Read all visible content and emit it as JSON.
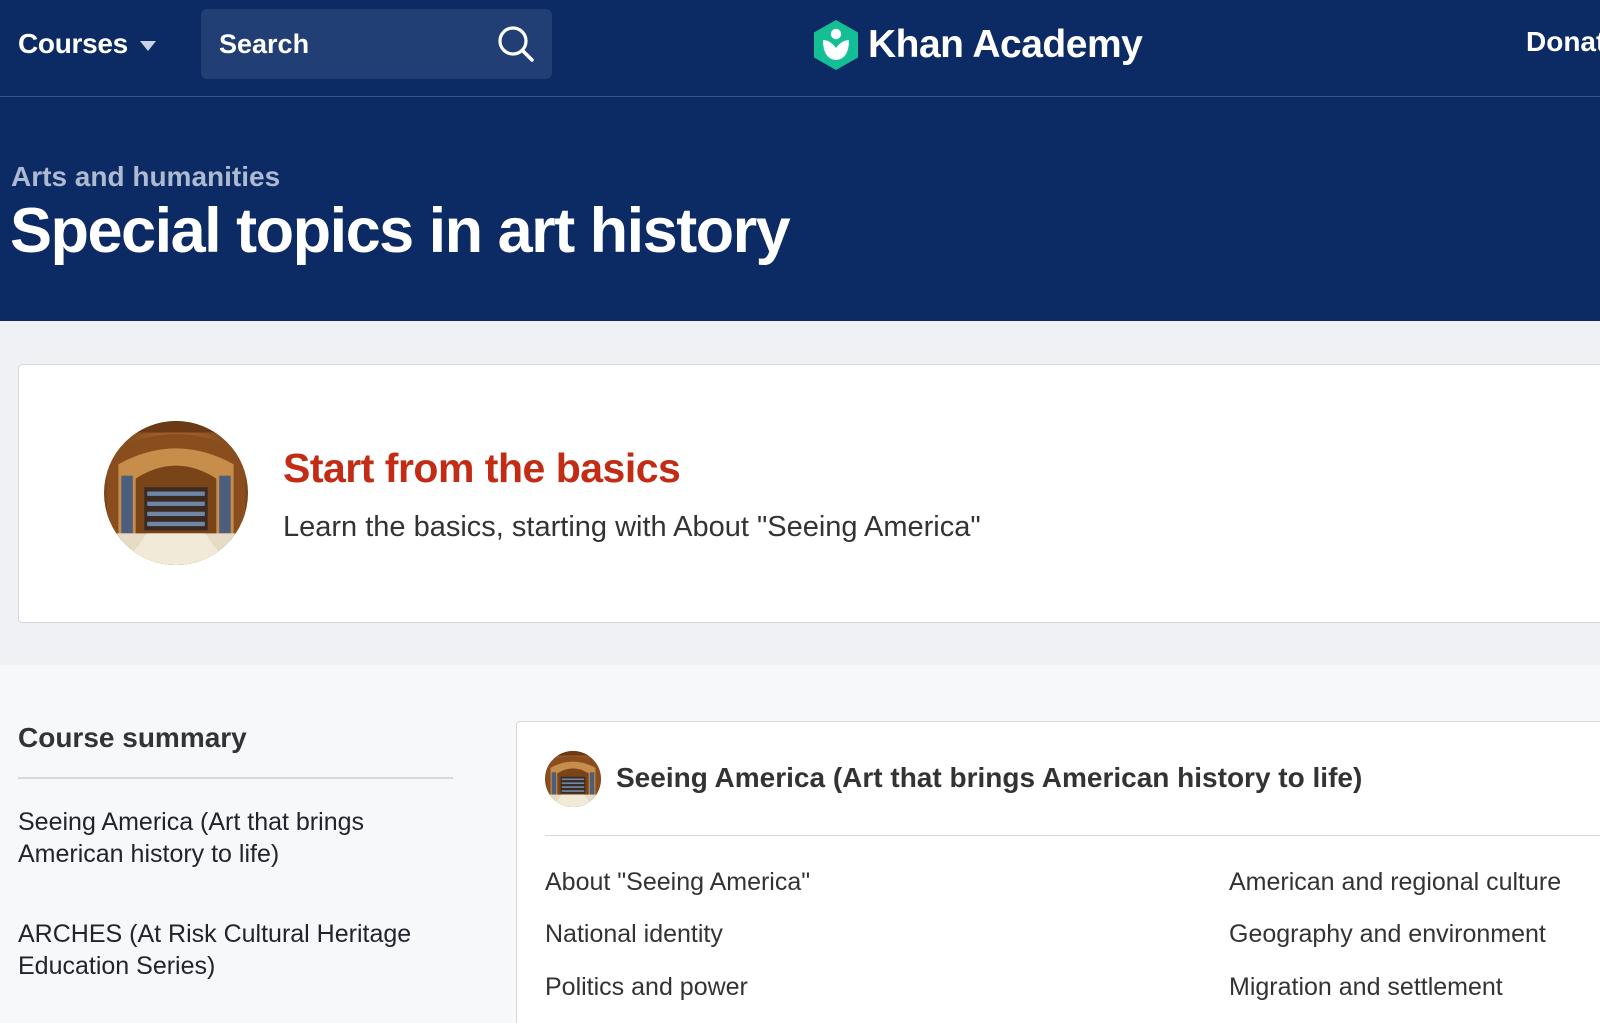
{
  "header": {
    "courses_label": "Courses",
    "search_placeholder": "Search",
    "brand_name": "Khan Academy",
    "donate_label": "Donate"
  },
  "hero": {
    "breadcrumb": "Arts and humanities",
    "title": "Special topics in art history"
  },
  "basics": {
    "title": "Start from the basics",
    "subtitle": "Learn the basics, starting with About \"Seeing America\""
  },
  "summary": {
    "heading": "Course summary",
    "items": [
      {
        "label": "Seeing America (Art that brings American history to life)"
      },
      {
        "label": "ARCHES (At Risk Cultural Heritage Education Series)"
      }
    ]
  },
  "unit": {
    "title": "Seeing America (Art that brings American history to life)",
    "lessons_left": [
      "About \"Seeing America\"",
      "National identity",
      "Politics and power"
    ],
    "lessons_right": [
      "American and regional culture",
      "Geography and environment",
      "Migration and settlement"
    ]
  },
  "colors": {
    "header_bg": "#0c2a63",
    "search_bg": "#213e75",
    "logo_green": "#14bf96",
    "basics_title": "#c22b14",
    "band_bg": "#eff1f4"
  },
  "icons": [
    "chevron-down-icon",
    "search-icon",
    "khan-academy-logo-icon",
    "library-thumbnail"
  ]
}
